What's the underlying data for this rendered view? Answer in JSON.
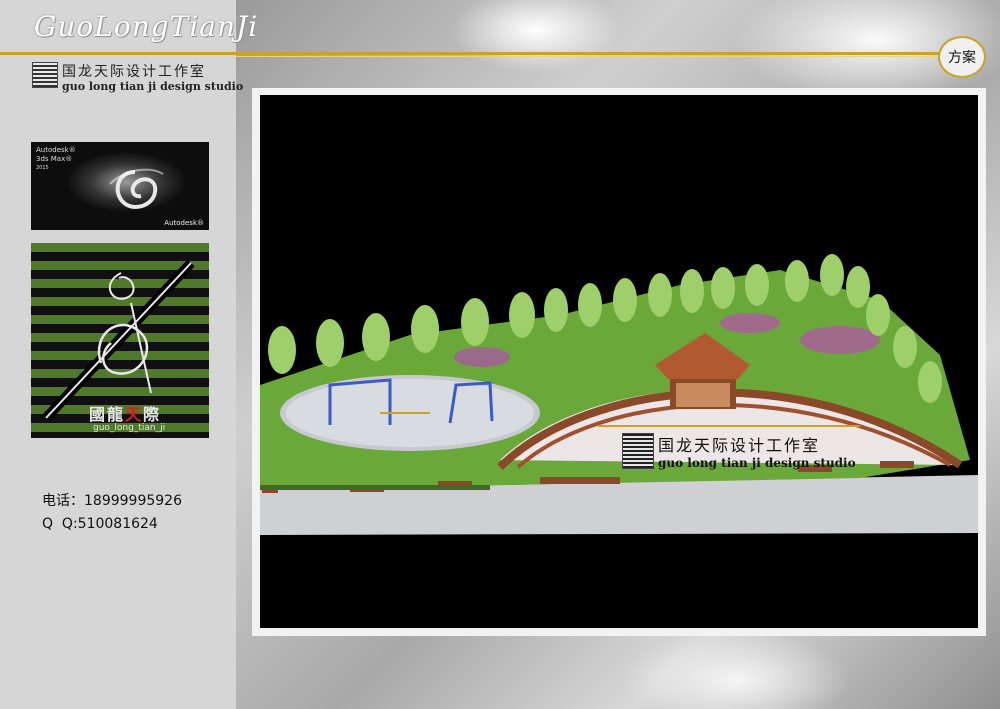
{
  "header": {
    "brand_logo_text": "GuoLongTianJi",
    "studio_name_cn": "国龙天际设计工作室",
    "studio_name_en": "guo long tian ji design studio",
    "section_badge": "方案"
  },
  "sidebar": {
    "software_logo": {
      "line1": "Autodesk®",
      "line2": "3ds Max®",
      "line3": "2015",
      "footer": "Autodesk®"
    },
    "brand_logo": {
      "text_cn_1": "國龍",
      "text_cn_2": "天",
      "text_cn_3": "際",
      "text_en": "guo_long_tian_ji"
    },
    "contact": {
      "phone_label": "电话：",
      "phone": "18999995926",
      "qq_label": "Q  Q:",
      "qq": "510081624"
    }
  },
  "rendering": {
    "watermark_cn": "国龙天际设计工作室",
    "watermark_en": "guo long tian ji design studio"
  },
  "colors": {
    "accent_gold": "#c9a227",
    "logo_green": "#4e7a2a",
    "logo_red": "#d02020"
  }
}
